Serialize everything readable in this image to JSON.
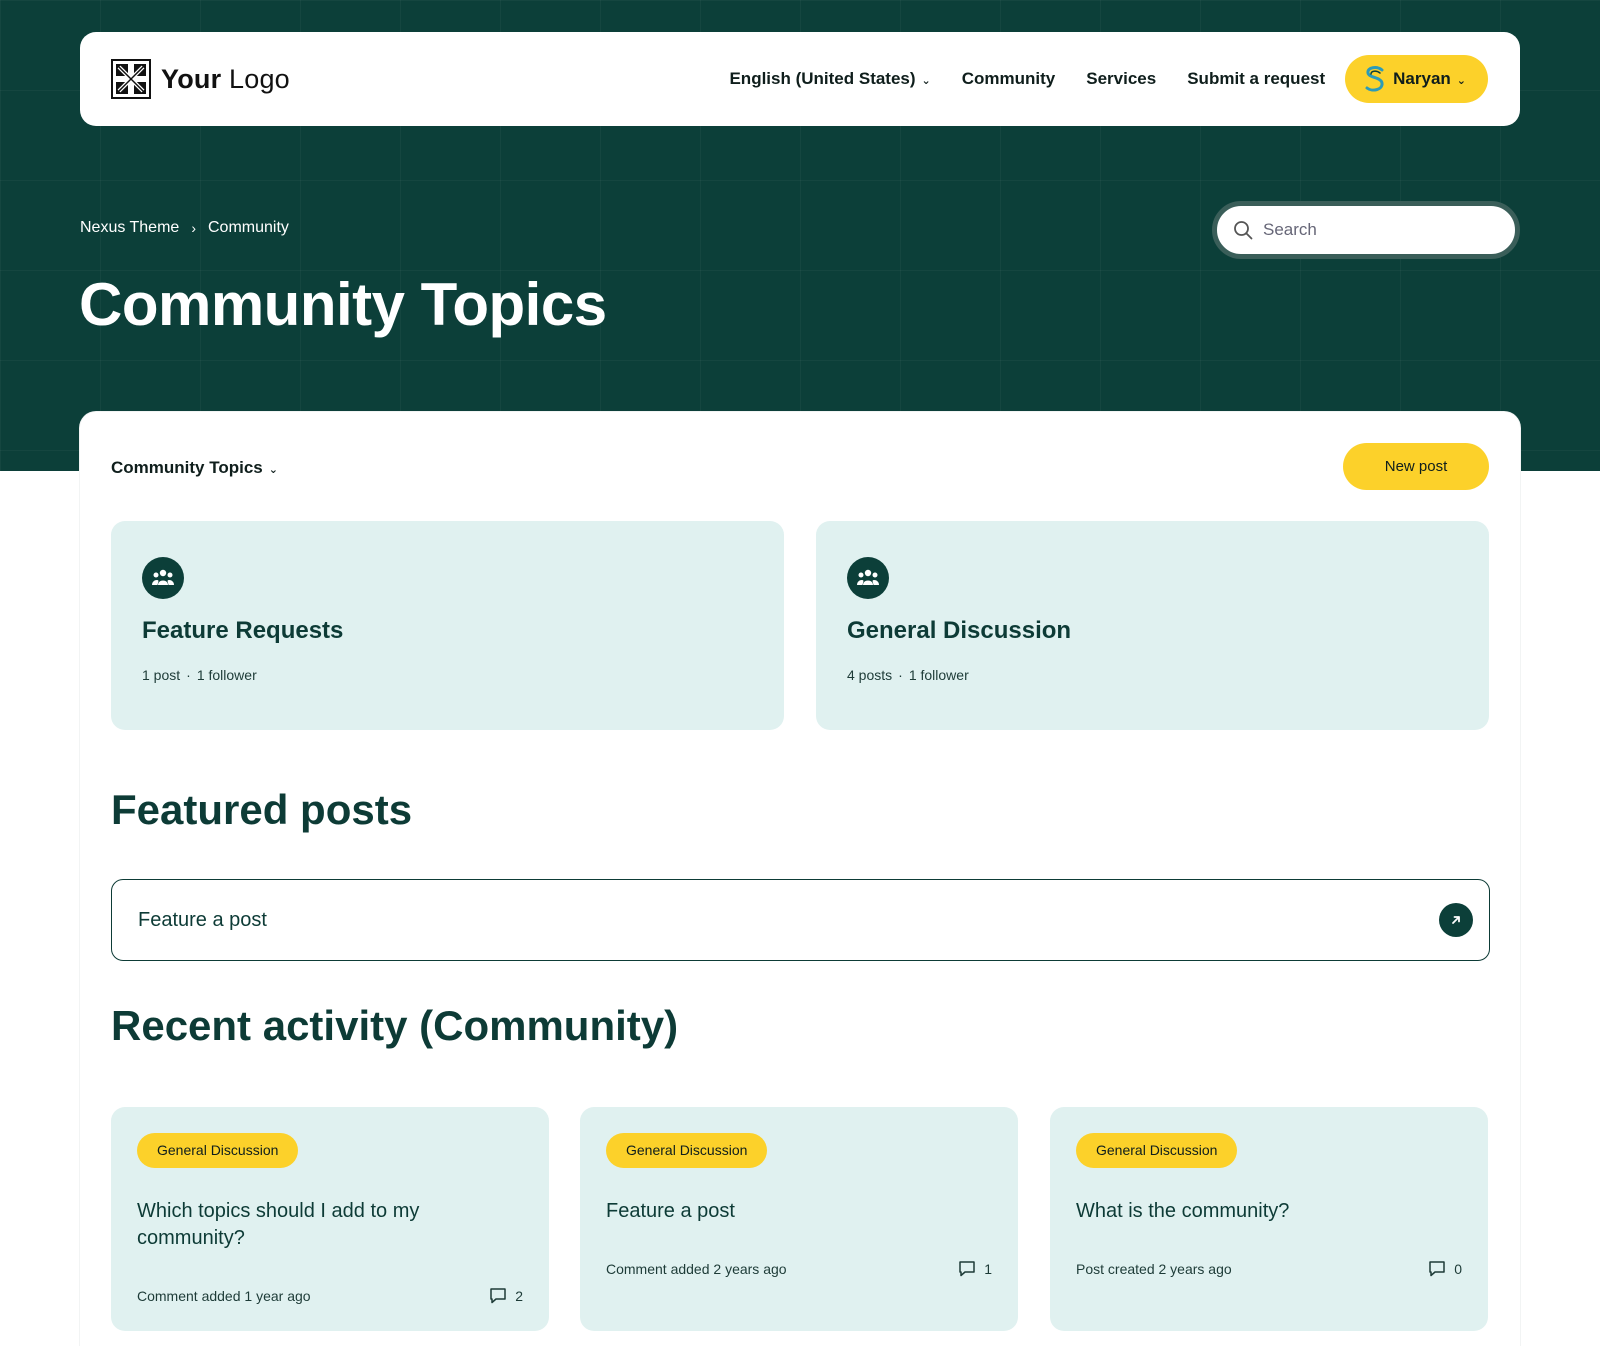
{
  "colors": {
    "brand_dark": "#0c3f39",
    "accent_yellow": "#fcd12a",
    "card_bg": "#e0f1f0"
  },
  "header": {
    "logo": {
      "bold": "Your",
      "light": " Logo",
      "icon": "logo-mark-icon"
    },
    "nav": [
      {
        "label": "English (United States)",
        "has_dropdown": true
      },
      {
        "label": "Community"
      },
      {
        "label": "Services"
      },
      {
        "label": "Submit a request"
      }
    ],
    "user": {
      "name": "Naryan",
      "has_dropdown": true
    }
  },
  "breadcrumb": [
    "Nexus Theme",
    "Community"
  ],
  "search": {
    "placeholder": "Search"
  },
  "page_title": "Community Topics",
  "topic_filter": {
    "label": "Community Topics"
  },
  "new_post_label": "New post",
  "topics": [
    {
      "name": "Feature Requests",
      "posts": "1 post",
      "followers": "1 follower",
      "icon": "people-group-icon"
    },
    {
      "name": "General Discussion",
      "posts": "4 posts",
      "followers": "1 follower",
      "icon": "people-group-icon"
    }
  ],
  "featured": {
    "heading": "Featured posts",
    "items": [
      {
        "label": "Feature a post",
        "icon": "arrow-up-right-icon"
      }
    ]
  },
  "recent": {
    "heading": "Recent activity (Community)",
    "items": [
      {
        "tag": "General Discussion",
        "title": "Which topics should I add to my community?",
        "status": "Comment added 1 year ago",
        "comments": "2"
      },
      {
        "tag": "General Discussion",
        "title": "Feature a post",
        "status": "Comment added 2 years ago",
        "comments": "1"
      },
      {
        "tag": "General Discussion",
        "title": "What is the community?",
        "status": "Post created 2 years ago",
        "comments": "0"
      }
    ]
  }
}
